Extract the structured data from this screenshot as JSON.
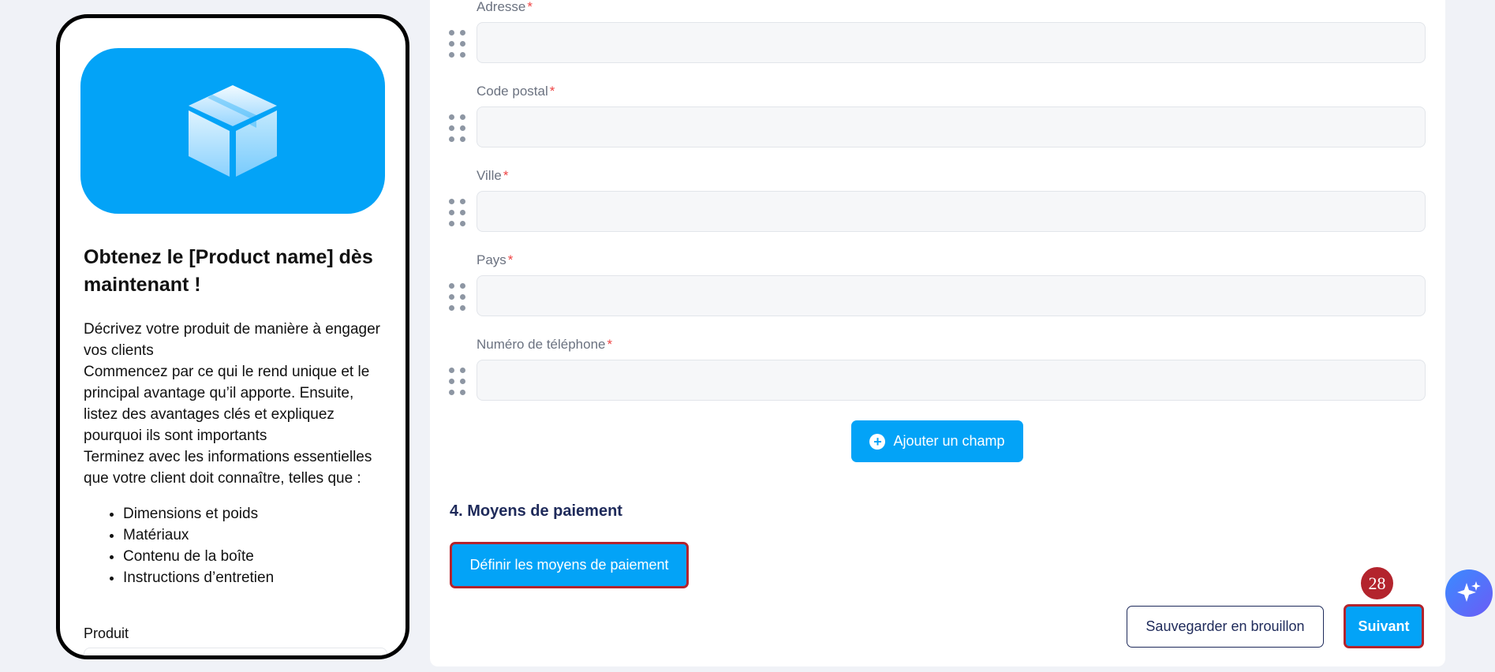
{
  "preview": {
    "title": "Obtenez le [Product name] dès maintenant !",
    "description": [
      "Décrivez votre produit de manière à engager vos clients",
      "Commencez par ce qui le rend unique et le principal avantage qu’il apporte. Ensuite, listez des avantages clés et expliquez pourquoi ils sont importants",
      "Terminez avec les informations essentielles que votre client doit connaître, telles que :"
    ],
    "list": [
      "Dimensions et poids",
      "Matériaux",
      "Contenu de la boîte",
      "Instructions d’entretien"
    ],
    "product_label": "Produit",
    "hero_icon": "box-icon",
    "hero_color": "#03a3f7"
  },
  "form": {
    "fields": [
      {
        "label": "Adresse",
        "required": "*",
        "value": ""
      },
      {
        "label": "Code postal",
        "required": "*",
        "value": ""
      },
      {
        "label": "Ville",
        "required": "*",
        "value": ""
      },
      {
        "label": "Pays",
        "required": "*",
        "value": ""
      },
      {
        "label": "Numéro de téléphone",
        "required": "*",
        "value": ""
      }
    ],
    "add_field_label": "Ajouter un champ"
  },
  "payment": {
    "section_title": "4. Moyens de paiement",
    "define_button": "Définir les moyens de paiement"
  },
  "footer": {
    "draft_button": "Sauvegarder en brouillon",
    "next_button": "Suivant",
    "step_badge": "28"
  },
  "colors": {
    "accent": "#03a3f7",
    "highlight": "#b3242d",
    "navy": "#1e2a5a",
    "required": "#ef4444"
  }
}
